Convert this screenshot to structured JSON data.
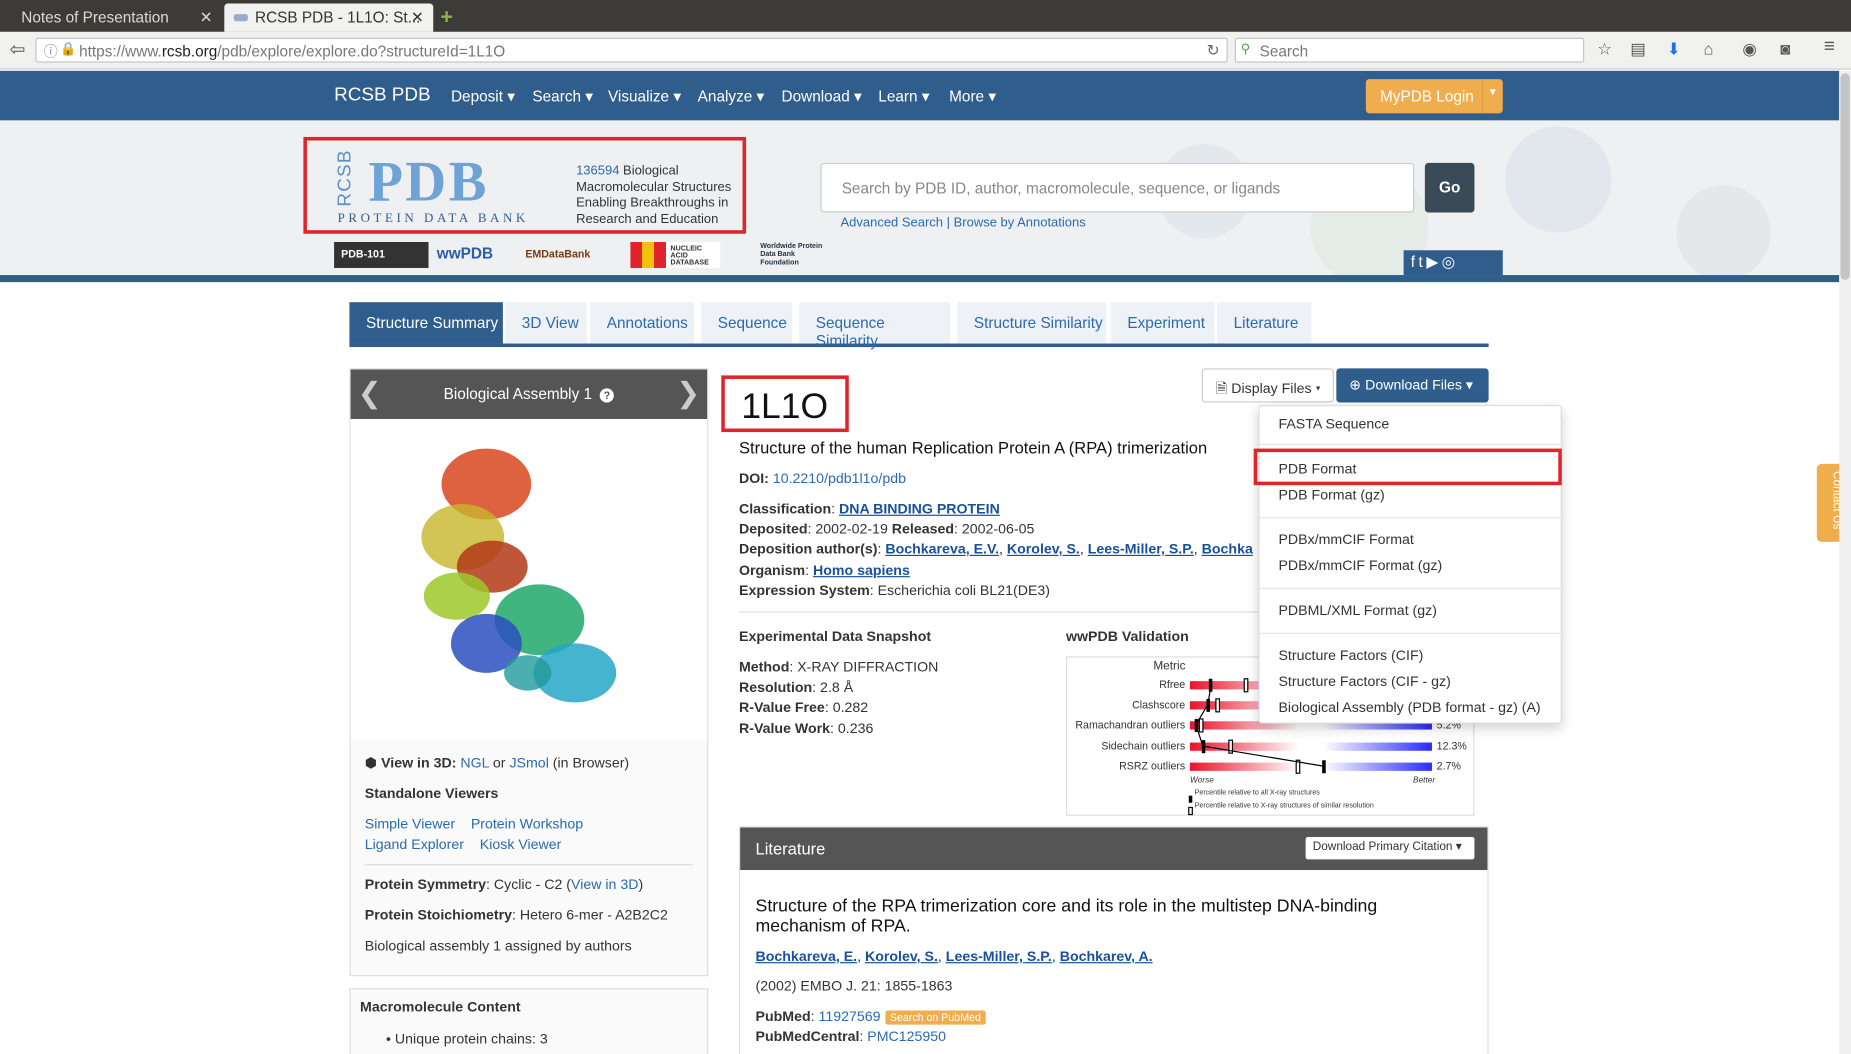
{
  "browser": {
    "tabs": [
      {
        "label": "Notes of Presentation"
      },
      {
        "label": "RCSB PDB - 1L1O: St..."
      }
    ],
    "url_prefix": "https://www.",
    "url_domain": "rcsb.org",
    "url_path": "/pdb/explore/explore.do?structureId=1L1O",
    "search_placeholder": "Search"
  },
  "site_nav": {
    "brand": "RCSB PDB",
    "menus": [
      "Deposit ▾",
      "Search ▾",
      "Visualize ▾",
      "Analyze ▾",
      "Download ▾",
      "Learn ▾",
      "More ▾"
    ],
    "login": "MyPDB Login"
  },
  "banner": {
    "logo_rcsb": "RCSB",
    "logo_pdb": "PDB",
    "logo_sub": "PROTEIN DATA BANK",
    "count": "136594",
    "tagline": " Biological Macromolecular Structures Enabling Breakthroughs in Research and Education",
    "partners": [
      "PDB-101",
      "wwPDB",
      "EMDataBank",
      "NUCLEIC ACID DATABASE",
      "Worldwide Protein Data Bank Foundation"
    ],
    "search_placeholder": "Search by PDB ID, author, macromolecule, sequence, or ligands",
    "go": "Go",
    "advanced": "Advanced Search | Browse by Annotations",
    "contact": "Contact Us"
  },
  "page_tabs": [
    "Structure Summary",
    "3D View",
    "Annotations",
    "Sequence",
    "Sequence Similarity",
    "Structure Similarity",
    "Experiment",
    "Literature"
  ],
  "left_panel": {
    "assembly": "Biological Assembly 1",
    "view3d_label": "View in 3D",
    "view3d_sep": ":",
    "ngl": "NGL",
    "or": "or",
    "jsmol": "JSmol",
    "in_browser": "(in Browser)",
    "standalone": "Standalone Viewers",
    "viewers": [
      "Simple Viewer",
      "Protein Workshop",
      "Ligand Explorer",
      "Kiosk Viewer"
    ],
    "symmetry_label": "Protein Symmetry",
    "symmetry_value": ": Cyclic - C2 (",
    "symmetry_link": "View in 3D",
    "symmetry_close": ")",
    "stoich_label": "Protein Stoichiometry",
    "stoich_value": ": Hetero 6-mer - A2B2C2",
    "assigned": "Biological assembly 1 assigned by authors",
    "macro_title": "Macromolecule Content",
    "macro_item": "Unique protein chains: 3"
  },
  "structure": {
    "id": "1L1O",
    "title": "Structure of the human Replication Protein A (RPA) trimerization",
    "doi_label": "DOI:",
    "doi": "10.2210/pdb1l1o/pdb",
    "classification_label": "Classification",
    "classification": "DNA BINDING PROTEIN",
    "deposited_label": "Deposited",
    "deposited": "2002-02-19",
    "released_label": "Released",
    "released": "2002-06-05",
    "authors_label": "Deposition author(s)",
    "authors": [
      "Bochkareva, E.V.",
      "Korolev, S.",
      "Lees-Miller, S.P.",
      "Bochka"
    ],
    "organism_label": "Organism",
    "organism": "Homo sapiens",
    "expression_label": "Expression System",
    "expression": "Escherichia coli BL21(DE3)"
  },
  "display_files": "Display Files",
  "download_files": "Download Files",
  "download_menu": [
    "FASTA Sequence",
    "PDB Format",
    "PDB Format (gz)",
    "PDBx/mmCIF Format",
    "PDBx/mmCIF Format (gz)",
    "PDBML/XML Format (gz)",
    "Structure Factors (CIF)",
    "Structure Factors (CIF - gz)",
    "Biological Assembly (PDB format - gz) (A)"
  ],
  "experimental": {
    "title": "Experimental Data Snapshot",
    "method_label": "Method",
    "method": "X-RAY DIFFRACTION",
    "resolution_label": "Resolution",
    "resolution": "2.8 Å",
    "rfree_label": "R-Value Free",
    "rfree": "0.282",
    "rwork_label": "R-Value Work",
    "rwork": "0.236"
  },
  "validation": {
    "title": "wwPDB Validation",
    "metric_header": "Metric",
    "rows": [
      {
        "label": "Rfree",
        "value": ""
      },
      {
        "label": "Clashscore",
        "value": ""
      },
      {
        "label": "Ramachandran outliers",
        "value": "5.2%"
      },
      {
        "label": "Sidechain outliers",
        "value": "12.3%"
      },
      {
        "label": "RSRZ outliers",
        "value": "2.7%"
      }
    ],
    "worse": "Worse",
    "better": "Better",
    "legend1": "Percentile relative to all X-ray structures",
    "legend2": "Percentile relative to X-ray structures of similar resolution"
  },
  "literature": {
    "header": "Literature",
    "download_citation": "Download Primary Citation ▾",
    "title": "Structure of the RPA trimerization core and its role in the multistep DNA-binding mechanism of RPA.",
    "authors": [
      "Bochkareva, E.",
      "Korolev, S.",
      "Lees-Miller, S.P.",
      "Bochkarev, A."
    ],
    "journal": "(2002) EMBO J. 21: 1855-1863",
    "pubmed_label": "PubMed",
    "pubmed": "11927569",
    "search_pubmed": "Search on PubMed",
    "pmc_label": "PubMedCentral",
    "pmc": "PMC125950"
  }
}
